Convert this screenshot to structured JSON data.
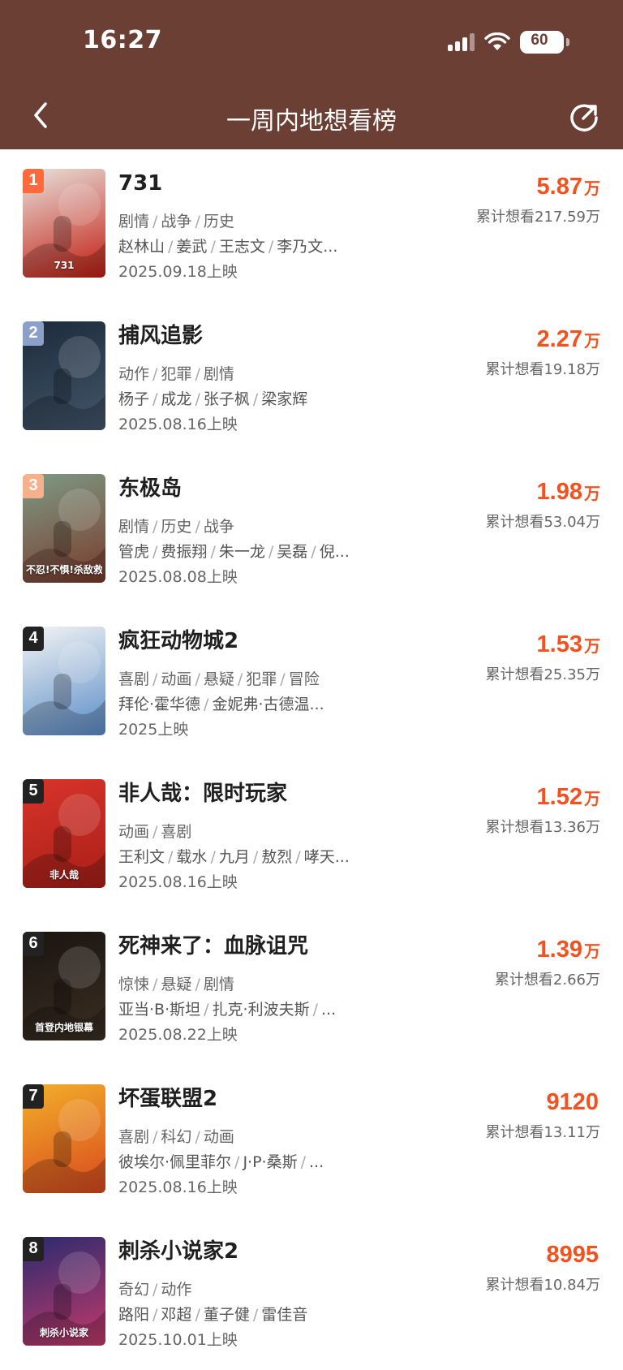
{
  "status_bar": {
    "time": "16:27",
    "battery": "60"
  },
  "header": {
    "title": "一周内地想看榜"
  },
  "items": [
    {
      "rank": "1",
      "title": "731",
      "genres": [
        "剧情",
        "战争",
        "历史"
      ],
      "cast": [
        "赵林山",
        "姜武",
        "王志文",
        "李乃文..."
      ],
      "date": "2025.09.18上映",
      "score": "5.87",
      "unit": "万",
      "cumulative": "累计想看217.59万",
      "rank_color": "#ff6a3d",
      "poster_colors": [
        "#e8e2dc",
        "#c21c10"
      ],
      "poster_text": "731"
    },
    {
      "rank": "2",
      "title": "捕风追影",
      "genres": [
        "动作",
        "犯罪",
        "剧情"
      ],
      "cast": [
        "杨子",
        "成龙",
        "张子枫",
        "梁家辉"
      ],
      "date": "2025.08.16上映",
      "score": "2.27",
      "unit": "万",
      "cumulative": "累计想看19.18万",
      "rank_color": "#8aa0c8",
      "poster_colors": [
        "#1c2a3a",
        "#44566b"
      ],
      "poster_text": ""
    },
    {
      "rank": "3",
      "title": "东极岛",
      "genres": [
        "剧情",
        "历史",
        "战争"
      ],
      "cast": [
        "管虎",
        "费振翔",
        "朱一龙",
        "吴磊",
        "倪..."
      ],
      "date": "2025.08.08上映",
      "score": "1.98",
      "unit": "万",
      "cumulative": "累计想看53.04万",
      "rank_color": "#f6b08a",
      "poster_colors": [
        "#7d9b87",
        "#7a3a2a"
      ],
      "poster_text": "不忍!不惧!杀敌救人!"
    },
    {
      "rank": "4",
      "title": "疯狂动物城2",
      "genres": [
        "喜剧",
        "动画",
        "悬疑",
        "犯罪",
        "冒险"
      ],
      "cast": [
        "拜伦·霍华德",
        "金妮弗·古德温..."
      ],
      "date": "2025上映",
      "score": "1.53",
      "unit": "万",
      "cumulative": "累计想看25.35万",
      "rank_color": "#222222",
      "poster_colors": [
        "#f4f4f4",
        "#5a8dc8"
      ],
      "poster_text": ""
    },
    {
      "rank": "5",
      "title": "非人哉：限时玩家",
      "genres": [
        "动画",
        "喜剧"
      ],
      "cast": [
        "王利文",
        "载水",
        "九月",
        "敖烈",
        "哮天..."
      ],
      "date": "2025.08.16上映",
      "score": "1.52",
      "unit": "万",
      "cumulative": "累计想看13.36万",
      "rank_color": "#222222",
      "poster_colors": [
        "#d8342a",
        "#a81f18"
      ],
      "poster_text": "非人哉"
    },
    {
      "rank": "6",
      "title": "死神来了：血脉诅咒",
      "genres": [
        "惊悚",
        "悬疑",
        "剧情"
      ],
      "cast": [
        "亚当·B·斯坦",
        "扎克·利波夫斯",
        "..."
      ],
      "date": "2025.08.22上映",
      "score": "1.39",
      "unit": "万",
      "cumulative": "累计想看2.66万",
      "rank_color": "#222222",
      "poster_colors": [
        "#1a1410",
        "#3a2e22"
      ],
      "poster_text": "首登内地银幕"
    },
    {
      "rank": "7",
      "title": "坏蛋联盟2",
      "genres": [
        "喜剧",
        "科幻",
        "动画"
      ],
      "cast": [
        "彼埃尔·佩里菲尔",
        "J·P·桑斯",
        "..."
      ],
      "date": "2025.08.16上映",
      "score": "9120",
      "unit": "",
      "cumulative": "累计想看13.11万",
      "rank_color": "#222222",
      "poster_colors": [
        "#f2b02a",
        "#d9481e"
      ],
      "poster_text": ""
    },
    {
      "rank": "8",
      "title": "刺杀小说家2",
      "genres": [
        "奇幻",
        "动作"
      ],
      "cast": [
        "路阳",
        "邓超",
        "董子健",
        "雷佳音"
      ],
      "date": "2025.10.01上映",
      "score": "8995",
      "unit": "",
      "cumulative": "累计想看10.84万",
      "rank_color": "#222222",
      "poster_colors": [
        "#2a2a6e",
        "#c23a6a"
      ],
      "poster_text": "刺杀小说家"
    }
  ]
}
